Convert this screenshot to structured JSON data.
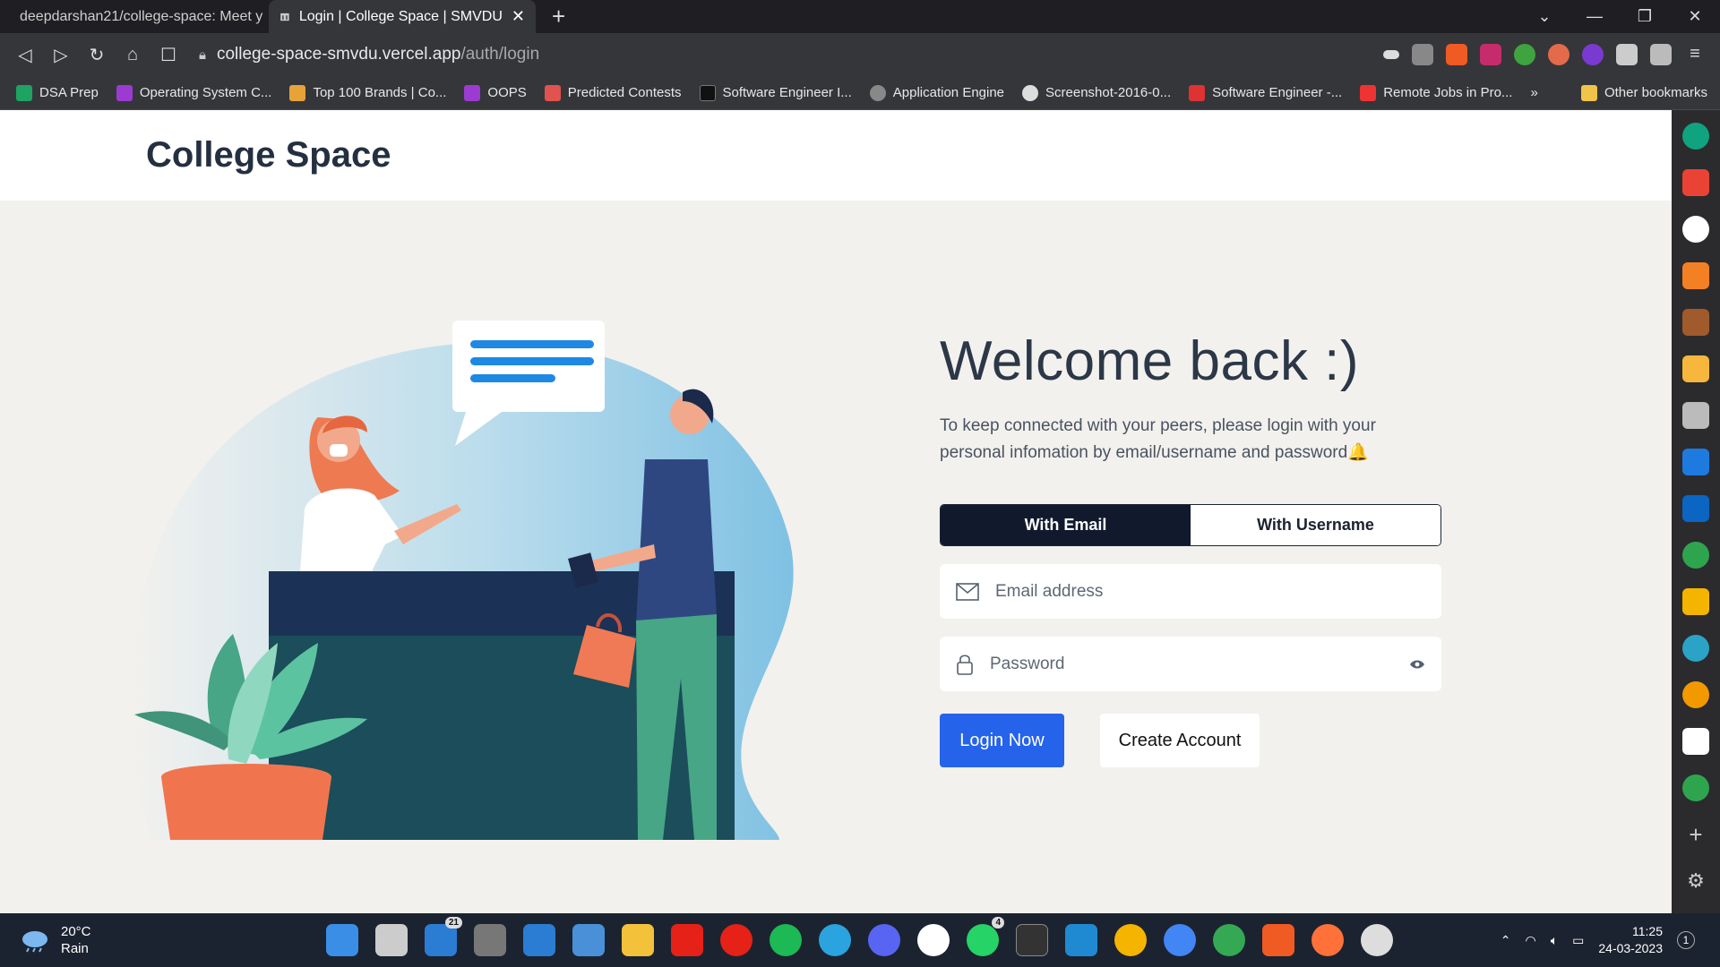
{
  "browser": {
    "tabs": [
      {
        "title": "deepdarshan21/college-space: Meet y",
        "active": false
      },
      {
        "title": "Login | College Space | SMVDU",
        "active": true
      }
    ],
    "url_host": "college-space-smvdu.vercel.app",
    "url_path": "/auth/login",
    "bookmarks": [
      {
        "label": "DSA Prep",
        "color": "#1ea362"
      },
      {
        "label": "Operating System C...",
        "color": "#9b3bd1"
      },
      {
        "label": "Top 100 Brands | Co...",
        "color": "#e8a23a"
      },
      {
        "label": "OOPS",
        "color": "#9b3bd1"
      },
      {
        "label": "Predicted Contests",
        "color": "#e0534e"
      },
      {
        "label": "Software Engineer I...",
        "color": "#222"
      },
      {
        "label": "Application Engine",
        "color": "#888"
      },
      {
        "label": "Screenshot-2016-0...",
        "color": "#ddd"
      },
      {
        "label": "Software Engineer -...",
        "color": "#d33"
      },
      {
        "label": "Remote Jobs in Pro...",
        "color": "#e33"
      }
    ],
    "bookmarks_more": "»",
    "other_bookmarks": "Other bookmarks"
  },
  "app": {
    "brand": "College Space",
    "welcome_title": "Welcome back :)",
    "subtitle": "To keep connected with your peers, please login with your personal infomation by email/username and password🔔",
    "tab_email": "With Email",
    "tab_username": "With Username",
    "email_placeholder": "Email address",
    "password_placeholder": "Password",
    "login_button": "Login Now",
    "create_button": "Create Account"
  },
  "taskbar": {
    "temperature": "20°C",
    "condition": "Rain",
    "time": "11:25",
    "date": "24-03-2023",
    "mail_badge": "21",
    "whatsapp_badge": "4",
    "notification_count": "1"
  },
  "colors": {
    "accent": "#2563eb",
    "dark": "#111a2c"
  }
}
